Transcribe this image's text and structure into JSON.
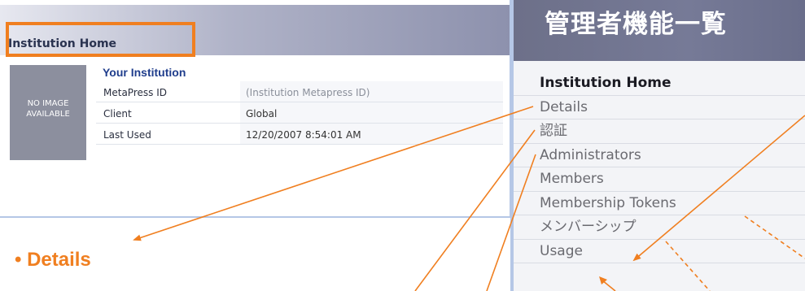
{
  "institution_panel": {
    "header_title": "Institution Home",
    "no_image_label": "NO IMAGE AVAILABLE",
    "institution_name": "Your Institution",
    "rows": [
      {
        "label": "MetaPress ID",
        "value": "(Institution Metapress ID)"
      },
      {
        "label": "Client",
        "value": "Global"
      },
      {
        "label": "Last Used",
        "value": "12/20/2007 8:54:01 AM"
      }
    ]
  },
  "caption": {
    "bullet_text": "• Details"
  },
  "admin_panel": {
    "title": "管理者機能一覧",
    "items": [
      {
        "label": "Institution Home"
      },
      {
        "label": "Details"
      },
      {
        "label": "認証"
      },
      {
        "label": "Administrators"
      },
      {
        "label": "Members"
      },
      {
        "label": "Membership Tokens"
      },
      {
        "label": "メンバーシップ"
      },
      {
        "label": "Usage"
      }
    ]
  },
  "colors": {
    "accent_orange": "#f07f20",
    "institution_blue": "#1f3d8c",
    "panel_border": "#b5c7e6"
  }
}
